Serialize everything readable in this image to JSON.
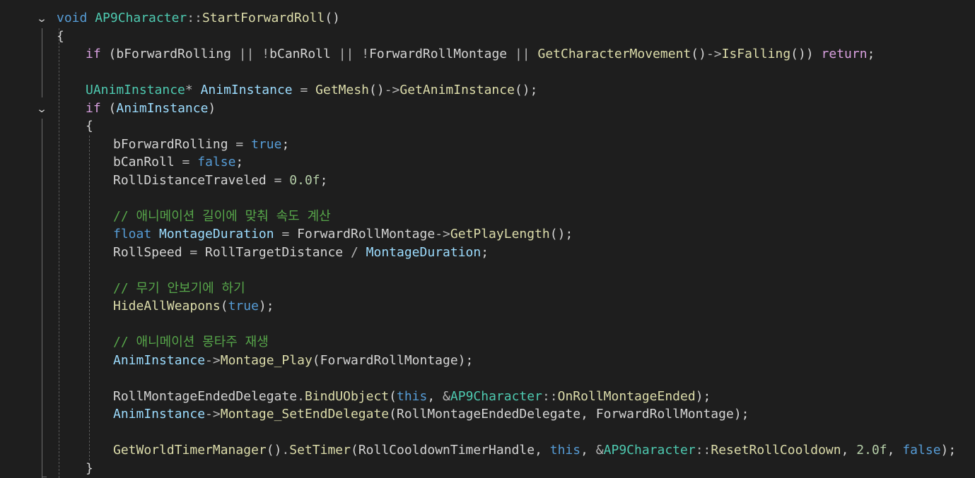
{
  "editor": {
    "language": "cpp",
    "colors": {
      "background": "#1e1e1e",
      "keyword": "#569cd6",
      "control": "#d8a0df",
      "type": "#4ec9b0",
      "function": "#dcdcaa",
      "local_variable": "#9cdcfe",
      "number": "#b5cea8",
      "comment": "#57a64a",
      "operator": "#b4b4b4",
      "plain": "#d4d4d4"
    },
    "lines": [
      {
        "indent": 0,
        "tokens": [
          [
            "kw",
            "void"
          ],
          [
            "plain",
            " "
          ],
          [
            "type",
            "AP9Character"
          ],
          [
            "op",
            "::"
          ],
          [
            "fn",
            "StartForwardRoll"
          ],
          [
            "plain",
            "()"
          ]
        ]
      },
      {
        "indent": 0,
        "tokens": [
          [
            "plain",
            "{"
          ]
        ]
      },
      {
        "indent": 1,
        "tokens": [
          [
            "ctrl",
            "if"
          ],
          [
            "plain",
            " (bForwardRolling "
          ],
          [
            "op",
            "||"
          ],
          [
            "plain",
            " "
          ],
          [
            "op",
            "!"
          ],
          [
            "plain",
            "bCanRoll "
          ],
          [
            "op",
            "||"
          ],
          [
            "plain",
            " "
          ],
          [
            "op",
            "!"
          ],
          [
            "plain",
            "ForwardRollMontage "
          ],
          [
            "op",
            "||"
          ],
          [
            "plain",
            " "
          ],
          [
            "fn",
            "GetCharacterMovement"
          ],
          [
            "plain",
            "()"
          ],
          [
            "op",
            "->"
          ],
          [
            "fn",
            "IsFalling"
          ],
          [
            "plain",
            "()) "
          ],
          [
            "ctrl",
            "return"
          ],
          [
            "plain",
            ";"
          ]
        ]
      },
      {
        "indent": 0,
        "tokens": []
      },
      {
        "indent": 1,
        "tokens": [
          [
            "type",
            "UAnimInstance"
          ],
          [
            "op",
            "*"
          ],
          [
            "plain",
            " "
          ],
          [
            "lvar",
            "AnimInstance"
          ],
          [
            "plain",
            " "
          ],
          [
            "op",
            "="
          ],
          [
            "plain",
            " "
          ],
          [
            "fn",
            "GetMesh"
          ],
          [
            "plain",
            "()"
          ],
          [
            "op",
            "->"
          ],
          [
            "fn",
            "GetAnimInstance"
          ],
          [
            "plain",
            "();"
          ]
        ]
      },
      {
        "indent": 1,
        "tokens": [
          [
            "ctrl",
            "if"
          ],
          [
            "plain",
            " ("
          ],
          [
            "lvar",
            "AnimInstance"
          ],
          [
            "plain",
            ")"
          ]
        ]
      },
      {
        "indent": 1,
        "tokens": [
          [
            "plain",
            "{"
          ]
        ]
      },
      {
        "indent": 2,
        "tokens": [
          [
            "plain",
            "bForwardRolling "
          ],
          [
            "op",
            "="
          ],
          [
            "plain",
            " "
          ],
          [
            "kw",
            "true"
          ],
          [
            "plain",
            ";"
          ]
        ]
      },
      {
        "indent": 2,
        "tokens": [
          [
            "plain",
            "bCanRoll "
          ],
          [
            "op",
            "="
          ],
          [
            "plain",
            " "
          ],
          [
            "kw",
            "false"
          ],
          [
            "plain",
            ";"
          ]
        ]
      },
      {
        "indent": 2,
        "tokens": [
          [
            "plain",
            "RollDistanceTraveled "
          ],
          [
            "op",
            "="
          ],
          [
            "plain",
            " "
          ],
          [
            "num",
            "0.0f"
          ],
          [
            "plain",
            ";"
          ]
        ]
      },
      {
        "indent": 0,
        "tokens": []
      },
      {
        "indent": 2,
        "tokens": [
          [
            "cmt",
            "// 애니메이션 길이에 맞춰 속도 계산"
          ]
        ]
      },
      {
        "indent": 2,
        "tokens": [
          [
            "kw",
            "float"
          ],
          [
            "plain",
            " "
          ],
          [
            "lvar",
            "MontageDuration"
          ],
          [
            "plain",
            " "
          ],
          [
            "op",
            "="
          ],
          [
            "plain",
            " ForwardRollMontage"
          ],
          [
            "op",
            "->"
          ],
          [
            "fn",
            "GetPlayLength"
          ],
          [
            "plain",
            "();"
          ]
        ]
      },
      {
        "indent": 2,
        "tokens": [
          [
            "plain",
            "RollSpeed "
          ],
          [
            "op",
            "="
          ],
          [
            "plain",
            " RollTargetDistance "
          ],
          [
            "op",
            "/"
          ],
          [
            "plain",
            " "
          ],
          [
            "lvar",
            "MontageDuration"
          ],
          [
            "plain",
            ";"
          ]
        ]
      },
      {
        "indent": 0,
        "tokens": []
      },
      {
        "indent": 2,
        "tokens": [
          [
            "cmt",
            "// 무기 안보기에 하기"
          ]
        ]
      },
      {
        "indent": 2,
        "tokens": [
          [
            "fn",
            "HideAllWeapons"
          ],
          [
            "plain",
            "("
          ],
          [
            "kw",
            "true"
          ],
          [
            "plain",
            ");"
          ]
        ]
      },
      {
        "indent": 0,
        "tokens": []
      },
      {
        "indent": 2,
        "tokens": [
          [
            "cmt",
            "// 애니메이션 몽타주 재생"
          ]
        ]
      },
      {
        "indent": 2,
        "tokens": [
          [
            "lvar",
            "AnimInstance"
          ],
          [
            "op",
            "->"
          ],
          [
            "fn",
            "Montage_Play"
          ],
          [
            "plain",
            "(ForwardRollMontage);"
          ]
        ]
      },
      {
        "indent": 0,
        "tokens": []
      },
      {
        "indent": 2,
        "tokens": [
          [
            "plain",
            "RollMontageEndedDelegate"
          ],
          [
            "op",
            "."
          ],
          [
            "fn",
            "BindUObject"
          ],
          [
            "plain",
            "("
          ],
          [
            "kw",
            "this"
          ],
          [
            "plain",
            ", "
          ],
          [
            "op",
            "&"
          ],
          [
            "type",
            "AP9Character"
          ],
          [
            "op",
            "::"
          ],
          [
            "fn",
            "OnRollMontageEnded"
          ],
          [
            "plain",
            ");"
          ]
        ]
      },
      {
        "indent": 2,
        "tokens": [
          [
            "lvar",
            "AnimInstance"
          ],
          [
            "op",
            "->"
          ],
          [
            "fn",
            "Montage_SetEndDelegate"
          ],
          [
            "plain",
            "(RollMontageEndedDelegate, ForwardRollMontage);"
          ]
        ]
      },
      {
        "indent": 0,
        "tokens": []
      },
      {
        "indent": 2,
        "tokens": [
          [
            "fn",
            "GetWorldTimerManager"
          ],
          [
            "plain",
            "()"
          ],
          [
            "op",
            "."
          ],
          [
            "fn",
            "SetTimer"
          ],
          [
            "plain",
            "(RollCooldownTimerHandle, "
          ],
          [
            "kw",
            "this"
          ],
          [
            "plain",
            ", "
          ],
          [
            "op",
            "&"
          ],
          [
            "type",
            "AP9Character"
          ],
          [
            "op",
            "::"
          ],
          [
            "fn",
            "ResetRollCooldown"
          ],
          [
            "plain",
            ", "
          ],
          [
            "num",
            "2.0f"
          ],
          [
            "plain",
            ", "
          ],
          [
            "kw",
            "false"
          ],
          [
            "plain",
            ");"
          ]
        ]
      },
      {
        "indent": 1,
        "tokens": [
          [
            "plain",
            "}"
          ]
        ]
      }
    ]
  }
}
